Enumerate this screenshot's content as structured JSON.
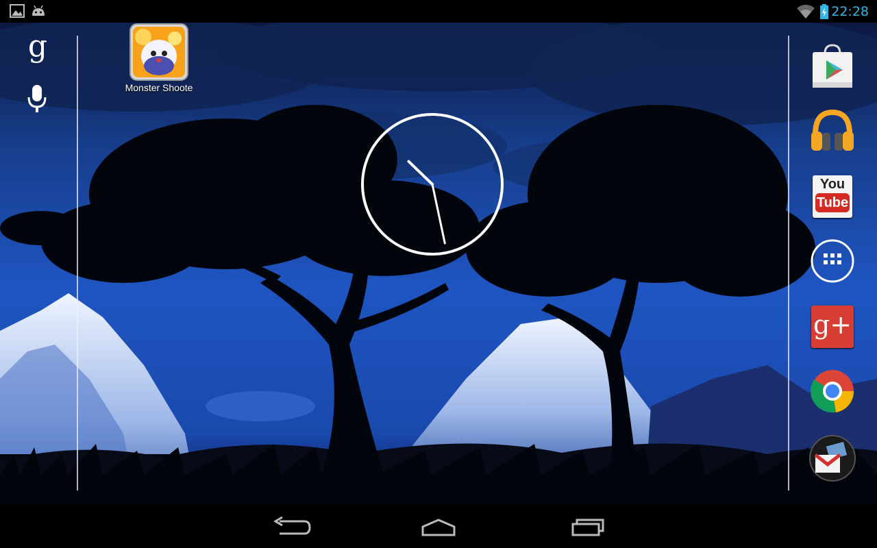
{
  "status_bar": {
    "time": "22:28",
    "icons": [
      "gallery-notification-icon",
      "android-notification-icon",
      "wifi-icon",
      "battery-icon"
    ]
  },
  "home": {
    "app_shortcut": {
      "label": "Monster Shoote",
      "icon": "monster-shooter-app-icon"
    },
    "left_panel": {
      "icons": [
        "google-search-icon",
        "voice-search-mic-icon"
      ],
      "search_glyph": "g"
    },
    "dock": [
      "play-store-icon",
      "play-music-icon",
      "youtube-icon",
      "all-apps-icon",
      "google-plus-icon",
      "chrome-icon",
      "gmail-icon"
    ],
    "youtube": {
      "line1": "You",
      "line2": "Tube"
    },
    "google_plus": {
      "text": "g+"
    },
    "clock": {
      "hour": 10,
      "minute": 28
    }
  },
  "nav_bar": {
    "buttons": [
      "back-icon",
      "home-icon",
      "recents-icon"
    ]
  },
  "colors": {
    "status_time": "#33b5e5",
    "sky": "#1d4fb8",
    "night": "#0a1233"
  }
}
